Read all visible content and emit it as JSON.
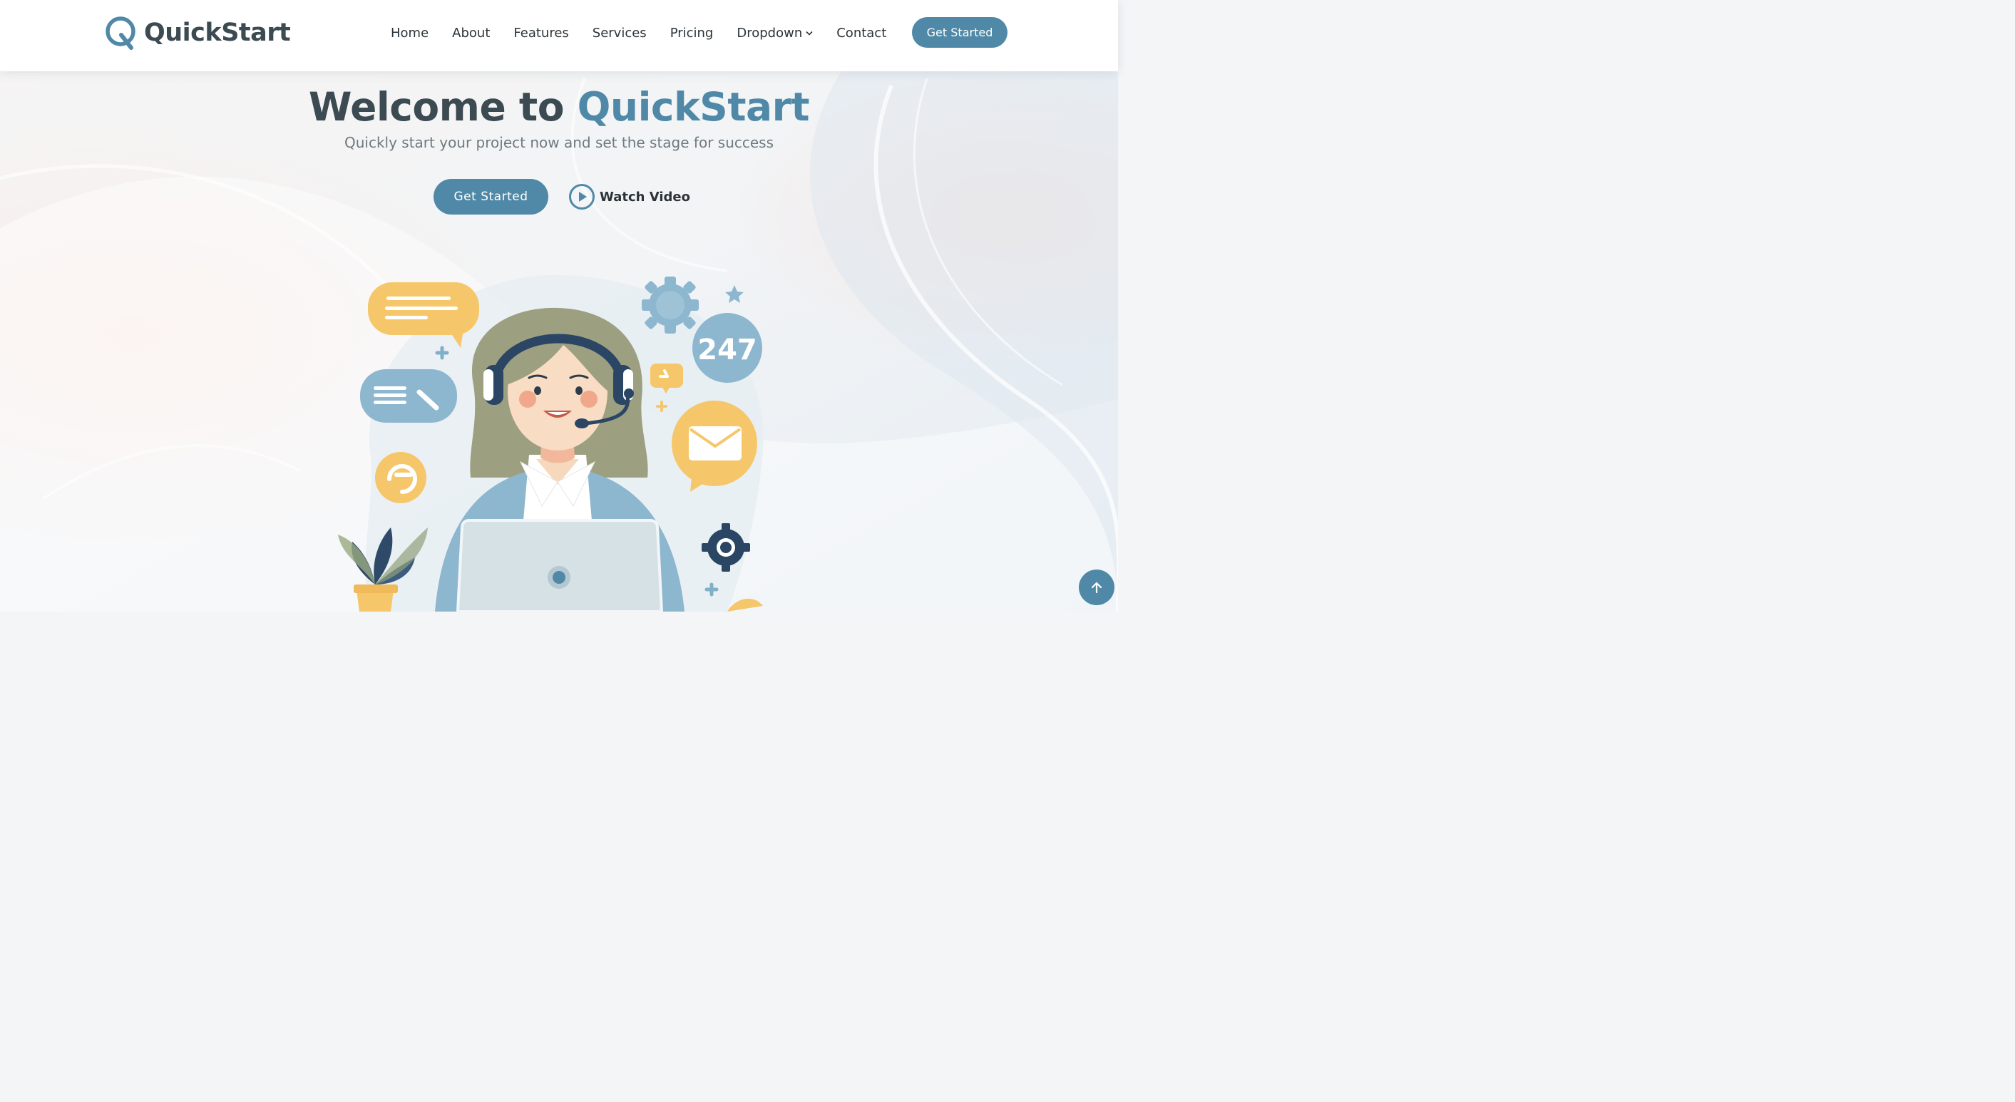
{
  "brand": {
    "name": "QuickStart",
    "accent_color": "#4f89a7",
    "text_color": "#3c4a52"
  },
  "nav": {
    "items": [
      {
        "label": "Home"
      },
      {
        "label": "About"
      },
      {
        "label": "Features"
      },
      {
        "label": "Services"
      },
      {
        "label": "Pricing"
      },
      {
        "label": "Dropdown",
        "icon": "chevron-down-icon"
      },
      {
        "label": "Contact"
      }
    ],
    "cta_label": "Get Started"
  },
  "hero": {
    "title_prefix": "Welcome to",
    "title_accent": "QuickStart",
    "subtitle": "Quickly start your project now and set the stage for success",
    "primary_button": "Get Started",
    "secondary_button": "Watch Video",
    "secondary_icon": "play-circle-icon"
  },
  "illustration": {
    "badge_text": "247",
    "subject": "customer-support-agent-illustration"
  },
  "scroll_top": {
    "icon": "arrow-up-icon"
  }
}
